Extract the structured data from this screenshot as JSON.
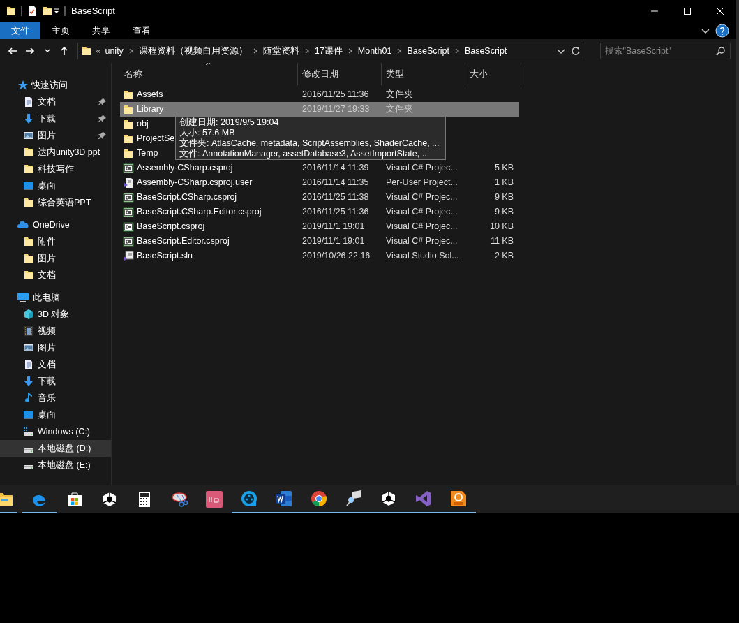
{
  "window": {
    "title": "BaseScript",
    "quick_access": [
      {
        "kind": "folder"
      },
      {
        "kind": "properties"
      },
      {
        "kind": "newfolder"
      },
      {
        "kind": "dropdown"
      }
    ]
  },
  "ribbon": {
    "tabs": [
      {
        "label": "文件",
        "kind": "file"
      },
      {
        "label": "主页",
        "kind": "tab"
      },
      {
        "label": "共享",
        "kind": "tab"
      },
      {
        "label": "查看",
        "kind": "tab"
      }
    ]
  },
  "address": {
    "overflow": "«",
    "crumbs": [
      "unity",
      "课程资料（视频自用资源）",
      "随堂资料",
      "17课件",
      "Month01",
      "BaseScript",
      "BaseScript"
    ]
  },
  "search": {
    "placeholder": "搜索\"BaseScript\""
  },
  "sidebar": {
    "items": [
      {
        "label": "快速访问",
        "kind": "star",
        "selected": false,
        "children": [
          {
            "label": "文档",
            "kind": "document",
            "pinned": true,
            "selected": false
          },
          {
            "label": "下载",
            "kind": "download",
            "pinned": true,
            "selected": false
          },
          {
            "label": "图片",
            "kind": "pictures",
            "pinned": true,
            "selected": false
          },
          {
            "label": "达内unity3D ppt",
            "kind": "folder",
            "pinned": false,
            "selected": false
          },
          {
            "label": "科技写作",
            "kind": "folder",
            "pinned": false,
            "selected": false
          },
          {
            "label": "桌面",
            "kind": "desktop",
            "pinned": false,
            "selected": false
          },
          {
            "label": "综合英语PPT",
            "kind": "folder",
            "pinned": false,
            "selected": false
          }
        ]
      },
      {
        "label": "OneDrive",
        "kind": "cloud",
        "selected": false,
        "children": [
          {
            "label": "附件",
            "kind": "folder",
            "pinned": false,
            "selected": false
          },
          {
            "label": "图片",
            "kind": "folder",
            "pinned": false,
            "selected": false
          },
          {
            "label": "文档",
            "kind": "folder",
            "pinned": false,
            "selected": false
          }
        ]
      },
      {
        "label": "此电脑",
        "kind": "computer",
        "selected": false,
        "children": [
          {
            "label": "3D 对象",
            "kind": "cube",
            "pinned": false,
            "selected": false
          },
          {
            "label": "视频",
            "kind": "video",
            "pinned": false,
            "selected": false
          },
          {
            "label": "图片",
            "kind": "pictures",
            "pinned": false,
            "selected": false
          },
          {
            "label": "文档",
            "kind": "document",
            "pinned": false,
            "selected": false
          },
          {
            "label": "下载",
            "kind": "download",
            "pinned": false,
            "selected": false
          },
          {
            "label": "音乐",
            "kind": "music",
            "pinned": false,
            "selected": false
          },
          {
            "label": "桌面",
            "kind": "desktop",
            "pinned": false,
            "selected": false
          },
          {
            "label": "Windows (C:)",
            "kind": "sysdrive",
            "pinned": false,
            "selected": false
          },
          {
            "label": "本地磁盘 (D:)",
            "kind": "drive",
            "pinned": false,
            "selected": true
          },
          {
            "label": "本地磁盘 (E:)",
            "kind": "drive",
            "pinned": false,
            "selected": false
          }
        ]
      }
    ]
  },
  "table": {
    "columns": [
      {
        "label": "名称",
        "sorted": true
      },
      {
        "label": "修改日期",
        "sorted": false
      },
      {
        "label": "类型",
        "sorted": false
      },
      {
        "label": "大小",
        "sorted": false
      }
    ],
    "rows": [
      {
        "kind": "folder",
        "name": "Assets",
        "date": "2016/11/25 11:36",
        "type": "文件夹",
        "selected": false
      },
      {
        "kind": "folder",
        "name": "Library",
        "date": "2019/11/27 19:33",
        "type": "文件夹",
        "selected": true
      },
      {
        "kind": "folder",
        "name": "obj",
        "selected": false
      },
      {
        "kind": "folder",
        "name": "ProjectSe",
        "selected": false
      },
      {
        "kind": "folder",
        "name": "Temp",
        "selected": false
      },
      {
        "kind": "csproj",
        "name": "Assembly-CSharp.csproj",
        "date": "2016/11/14 11:39",
        "type": "Visual C# Projec...",
        "size": "5 KB",
        "selected": false
      },
      {
        "kind": "user",
        "name": "Assembly-CSharp.csproj.user",
        "date": "2016/11/14 11:35",
        "type": "Per-User Project...",
        "size": "1 KB",
        "selected": false
      },
      {
        "kind": "csproj",
        "name": "BaseScript.CSharp.csproj",
        "date": "2016/11/25 11:38",
        "type": "Visual C# Projec...",
        "size": "9 KB",
        "selected": false
      },
      {
        "kind": "csproj",
        "name": "BaseScript.CSharp.Editor.csproj",
        "date": "2016/11/25 11:36",
        "type": "Visual C# Projec...",
        "size": "9 KB",
        "selected": false
      },
      {
        "kind": "csproj",
        "name": "BaseScript.csproj",
        "date": "2019/11/1 19:01",
        "type": "Visual C# Projec...",
        "size": "10 KB",
        "selected": false
      },
      {
        "kind": "csproj",
        "name": "BaseScript.Editor.csproj",
        "date": "2019/11/1 19:01",
        "type": "Visual C# Projec...",
        "size": "11 KB",
        "selected": false
      },
      {
        "kind": "sln",
        "name": "BaseScript.sln",
        "date": "2019/10/26 22:16",
        "type": "Visual Studio Sol...",
        "size": "2 KB",
        "selected": false
      }
    ]
  },
  "tooltip": {
    "lines": [
      "创建日期: 2019/9/5 19:04",
      "大小: 57.6 MB",
      "文件夹: AtlasCache, metadata, ScriptAssemblies, ShaderCache, ...",
      "文件: AnnotationManager, assetDatabase3, AssetImportState, ..."
    ]
  },
  "taskbar": {
    "items": [
      {
        "kind": "folder",
        "running": true
      },
      {
        "kind": "edge",
        "running": true
      },
      {
        "kind": "store",
        "running": false
      },
      {
        "kind": "unity",
        "running": false
      },
      {
        "kind": "calculator",
        "running": false
      },
      {
        "kind": "snip",
        "running": false
      },
      {
        "kind": "pinkapp",
        "running": false
      },
      {
        "kind": "player",
        "running": true
      },
      {
        "kind": "word",
        "running": true
      },
      {
        "kind": "chrome",
        "running": true
      },
      {
        "kind": "remote",
        "running": true
      },
      {
        "kind": "unity",
        "running": true
      },
      {
        "kind": "vs",
        "running": true
      },
      {
        "kind": "pdf",
        "running": true
      }
    ]
  }
}
